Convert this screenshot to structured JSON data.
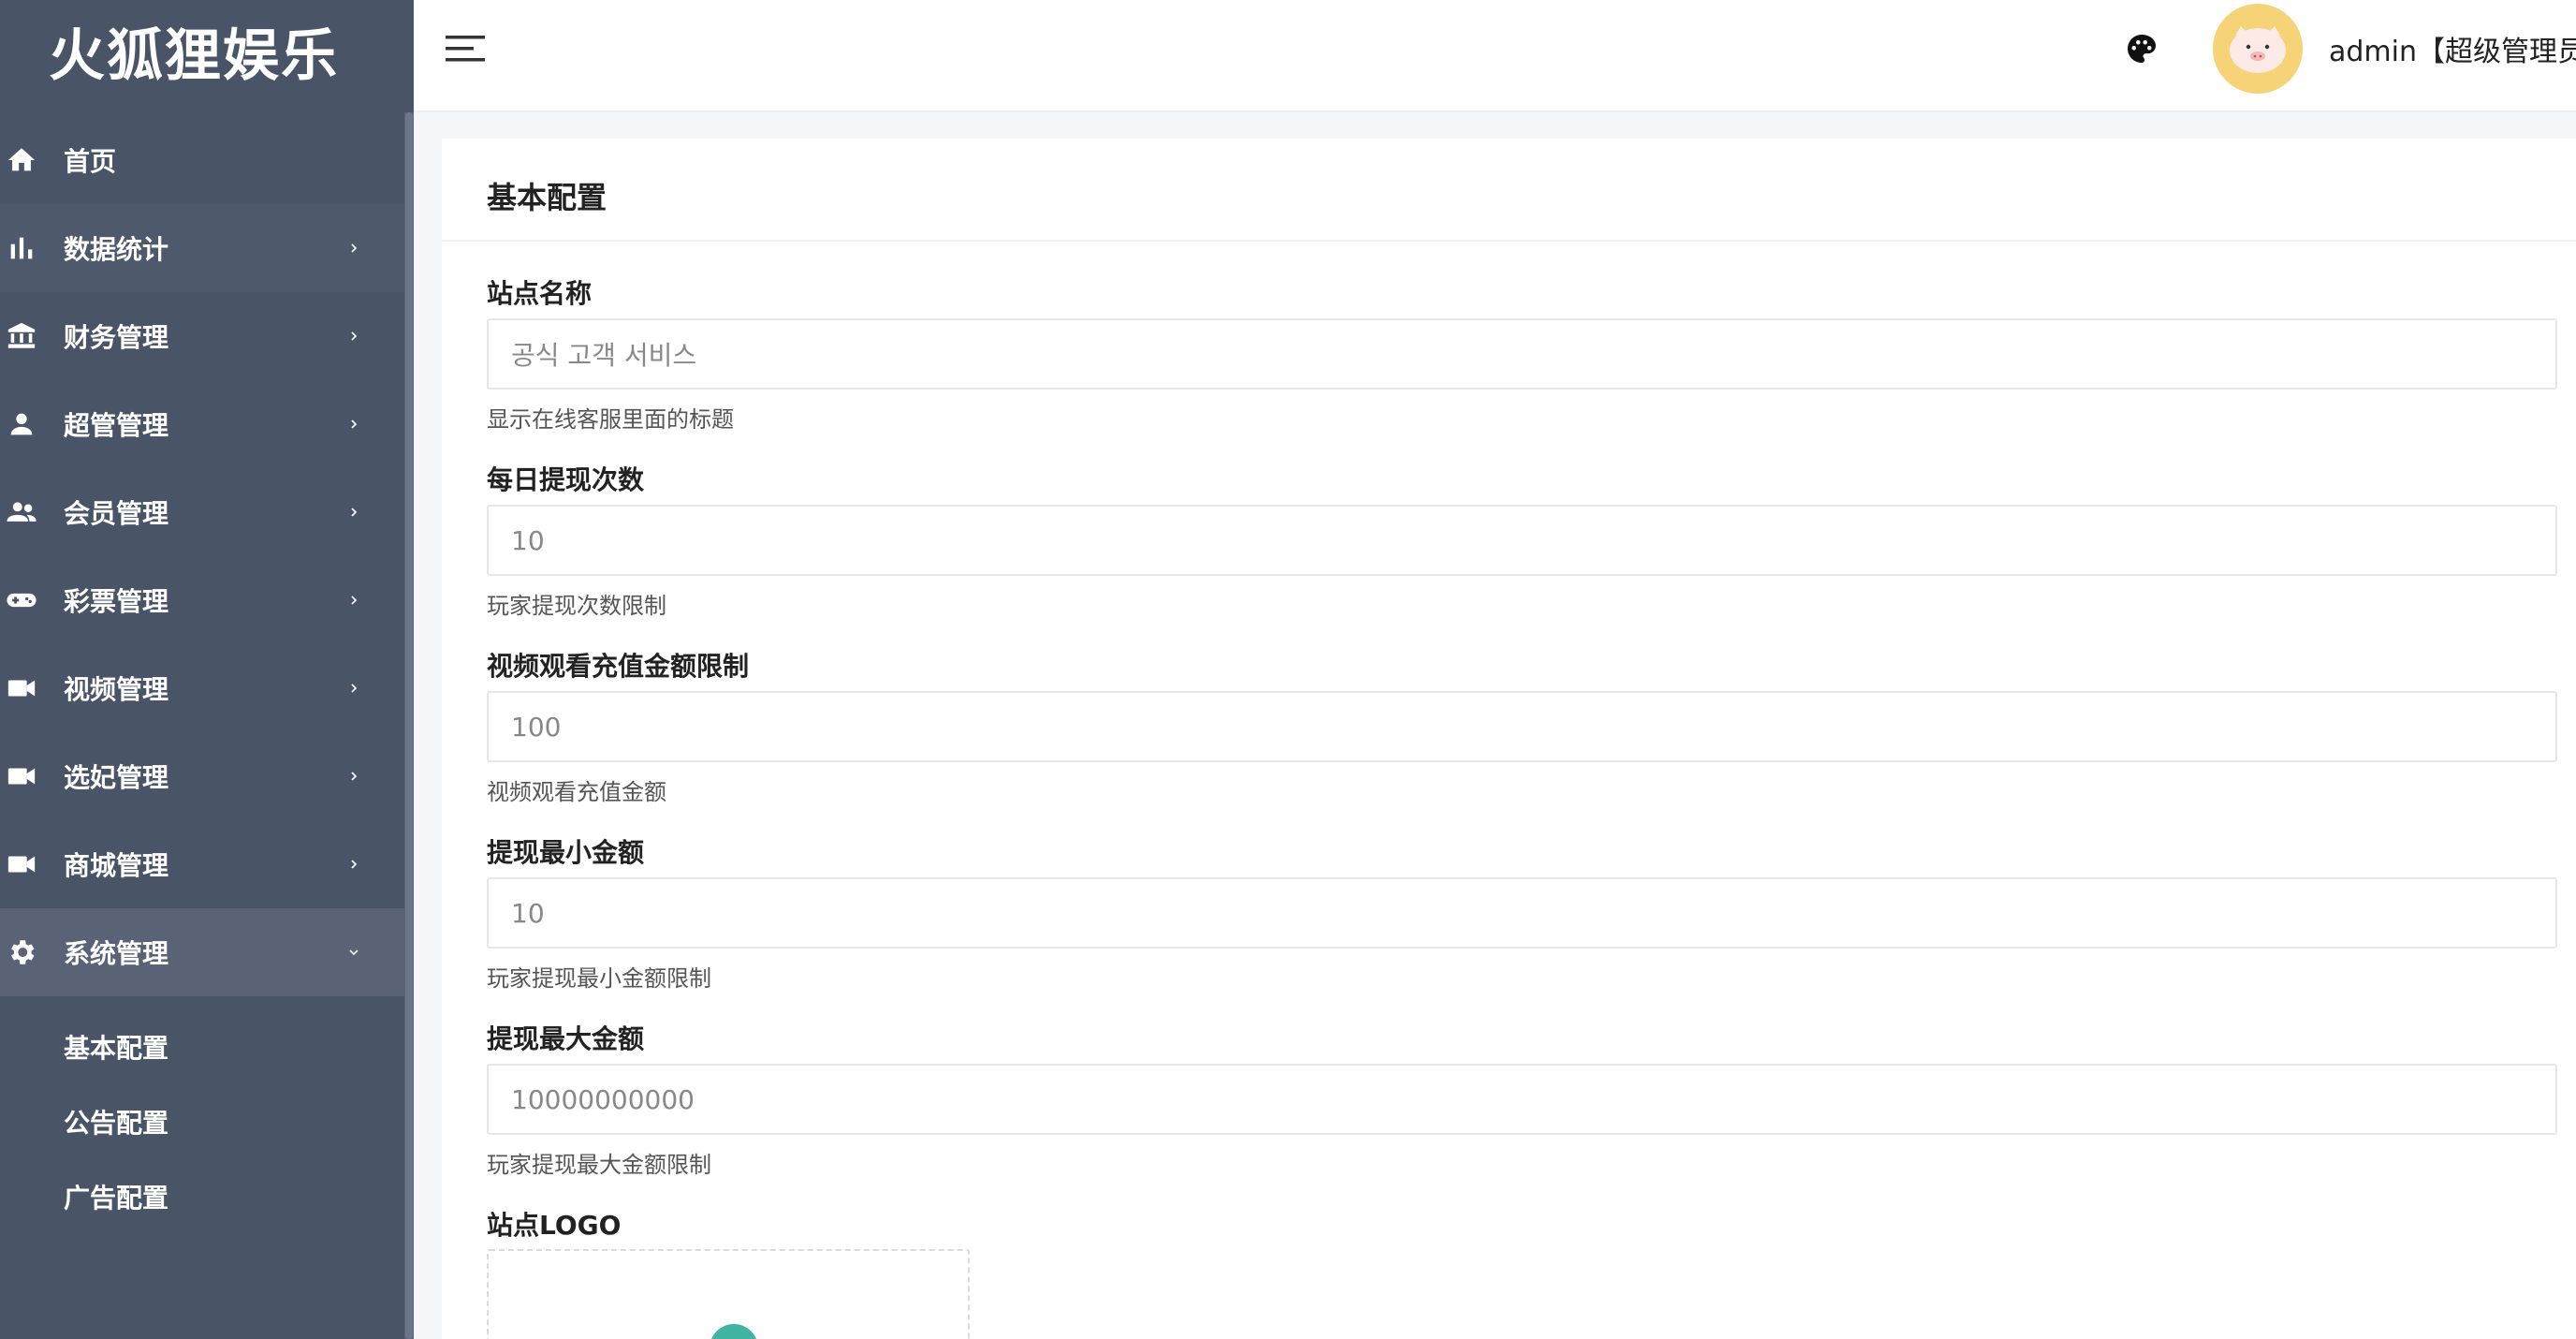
{
  "sidebar": {
    "brand": "火狐狸娱乐",
    "items": [
      {
        "label": "首页",
        "icon": "home-icon",
        "arrow": false
      },
      {
        "label": "数据统计",
        "icon": "bar-chart-icon",
        "arrow": true
      },
      {
        "label": "财务管理",
        "icon": "bank-icon",
        "arrow": true
      },
      {
        "label": "超管管理",
        "icon": "person-icon",
        "arrow": true
      },
      {
        "label": "会员管理",
        "icon": "group-icon",
        "arrow": true
      },
      {
        "label": "彩票管理",
        "icon": "gamepad-icon",
        "arrow": true
      },
      {
        "label": "视频管理",
        "icon": "video-camera-icon",
        "arrow": true
      },
      {
        "label": "选妃管理",
        "icon": "video-camera-icon",
        "arrow": true
      },
      {
        "label": "商城管理",
        "icon": "video-camera-icon",
        "arrow": true
      },
      {
        "label": "系统管理",
        "icon": "gear-icon",
        "arrow": true,
        "open": true
      }
    ],
    "subitems": [
      "基本配置",
      "公告配置",
      "广告配置"
    ]
  },
  "header": {
    "username": "admin【超级管理员】"
  },
  "panel": {
    "title": "基本配置",
    "fields": [
      {
        "label": "站点名称",
        "value": "공식 고객 서비스",
        "help": "显示在线客服里面的标题"
      },
      {
        "label": "每日提现次数",
        "value": "10",
        "help": "玩家提现次数限制"
      },
      {
        "label": "视频观看充值金额限制",
        "value": "100",
        "help": "视频观看充值金额"
      },
      {
        "label": "提现最小金额",
        "value": "10",
        "help": "玩家提现最小金额限制"
      },
      {
        "label": "提现最大金额",
        "value": "10000000000",
        "help": "玩家提现最大金额限制"
      }
    ],
    "logo_label": "站点LOGO"
  },
  "colors": {
    "sidebar_bg": "#4a5467",
    "accent_teal": "#3fb4a0",
    "avatar_bg": "#f6d377"
  }
}
